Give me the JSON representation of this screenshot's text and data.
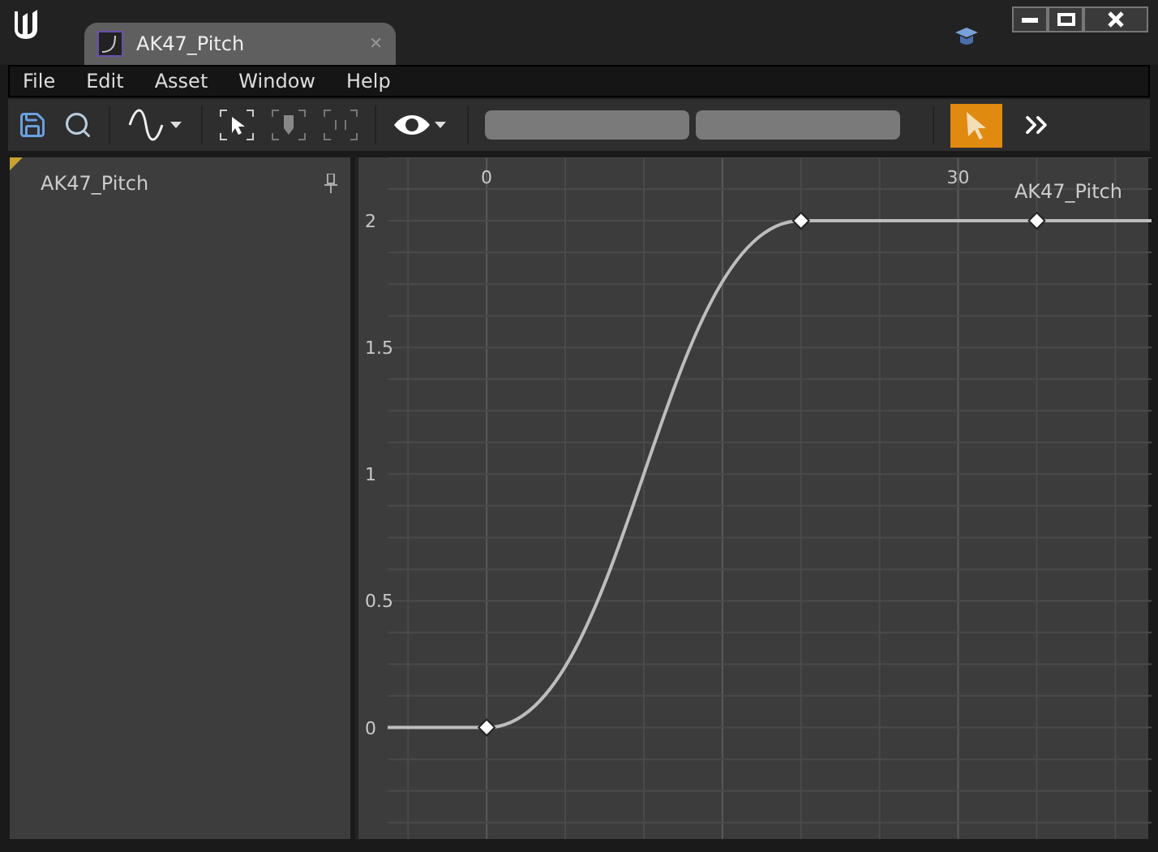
{
  "window": {
    "tab_title": "AK47_Pitch",
    "tab_close": "✕"
  },
  "menu": [
    "File",
    "Edit",
    "Asset",
    "Window",
    "Help"
  ],
  "curve_list": {
    "items": [
      {
        "name": "AK47_Pitch"
      }
    ]
  },
  "graph": {
    "chart_data": {
      "type": "line",
      "grid": true,
      "x": [
        -6.3,
        0,
        20,
        35,
        42.3
      ],
      "series": [
        {
          "name": "AK47_Pitch",
          "color": "#bdbdbd",
          "marker": "diamond",
          "values": [
            0,
            0,
            2,
            2,
            2
          ]
        }
      ],
      "xlim": [
        -6.3,
        42.3
      ],
      "ylim": [
        -0.44,
        2.25
      ],
      "xticks": [
        0,
        30
      ],
      "yticks": [
        0,
        0.5,
        1,
        1.5,
        2
      ]
    }
  }
}
